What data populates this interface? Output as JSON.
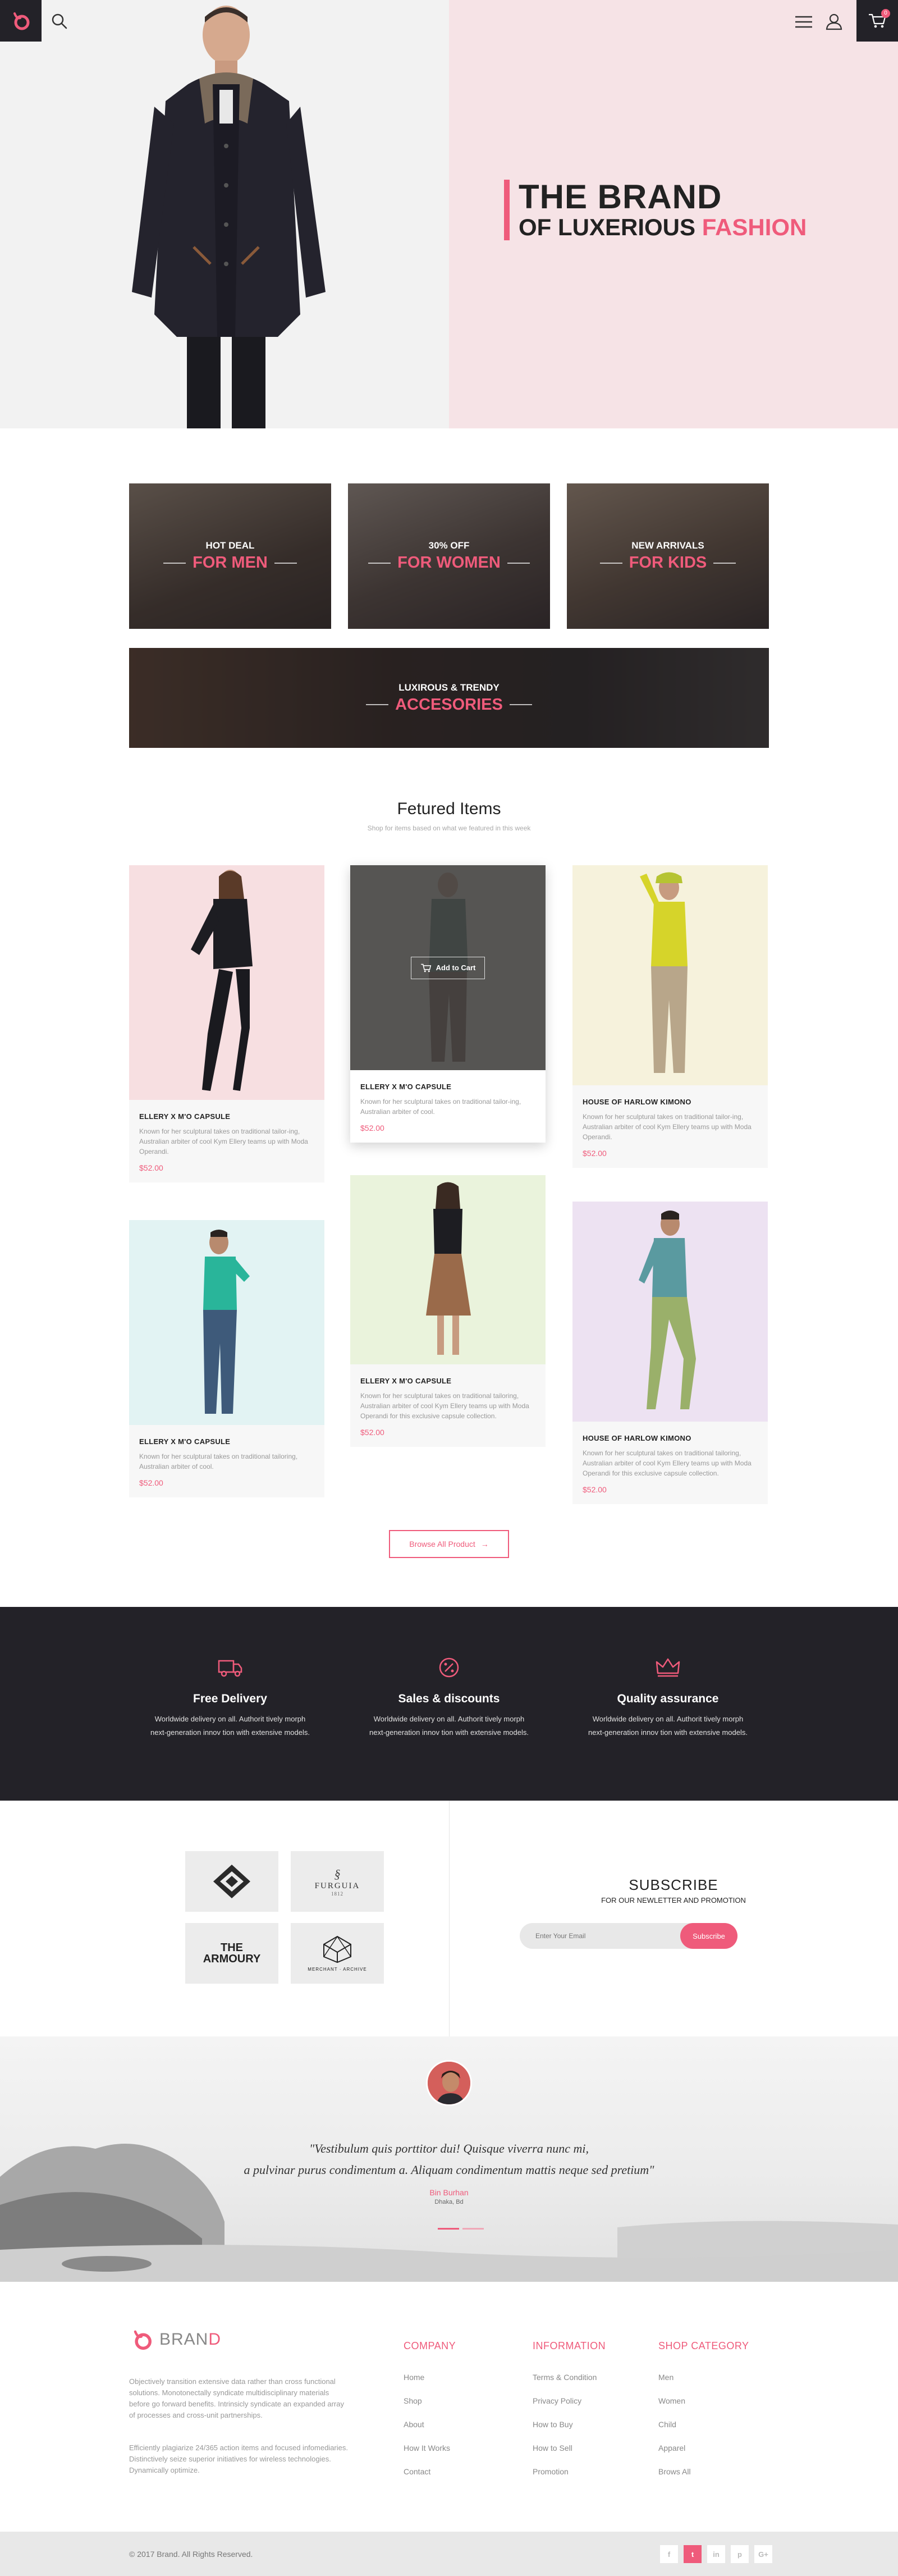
{
  "header": {
    "cart_count": "0"
  },
  "hero": {
    "line1": "THE BRAND",
    "line2_prefix": "OF LUXERIOUS",
    "line2_highlight": "FASHION"
  },
  "categories": [
    {
      "small": "HOT DEAL",
      "big": "FOR MEN"
    },
    {
      "small": "30% OFF",
      "big": "FOR WOMEN"
    },
    {
      "small": "NEW ARRIVALS",
      "big": "FOR KIDS"
    },
    {
      "small": "LUXIROUS & TRENDY",
      "big": "ACCESORIES"
    }
  ],
  "featured": {
    "title": "Fetured Items",
    "subtitle": "Shop for items based on what we featured in this week",
    "add_to_cart": "Add to Cart",
    "items": [
      {
        "name": "ELLERY X M'O CAPSULE",
        "desc": "Known for her sculptural takes on traditional tailor-ing, Australian arbiter of cool Kym Ellery teams up with Moda Operandi.",
        "price": "$52.00",
        "bg": "#f7dfe1"
      },
      {
        "name": "ELLERY X M'O CAPSULE",
        "desc": "Known for her sculptural takes on traditional tailor-ing, Australian arbiter of cool.",
        "price": "$52.00",
        "bg": "#e9e3d8"
      },
      {
        "name": "HOUSE OF HARLOW KIMONO",
        "desc": "Known for her sculptural takes on traditional tailor-ing, Australian arbiter of cool Kym Ellery teams up with Moda Operandi.",
        "price": "$52.00",
        "bg": "#f6f2dc"
      },
      {
        "name": "ELLERY X M'O CAPSULE",
        "desc": "Known for her sculptural takes on traditional tailoring, Australian arbiter of cool.",
        "price": "$52.00",
        "bg": "#e2f3f3"
      },
      {
        "name": "ELLERY X M'O CAPSULE",
        "desc": "Known for her sculptural takes on traditional tailoring, Australian arbiter of cool Kym Ellery teams up with Moda Operandi for this exclusive capsule collection.",
        "price": "$52.00",
        "bg": "#eaf3dc"
      },
      {
        "name": "HOUSE OF HARLOW KIMONO",
        "desc": "Known for her sculptural takes on traditional tailoring, Australian arbiter of cool Kym Ellery teams up with Moda Operandi for this exclusive capsule collection.",
        "price": "$52.00",
        "bg": "#ede2f2"
      }
    ],
    "browse_label": "Browse All Product"
  },
  "features": [
    {
      "title": "Free Delivery",
      "desc_1": "Worldwide delivery on all. Authorit tively morph",
      "desc_2": "next-generation innov tion with extensive models."
    },
    {
      "title": "Sales & discounts",
      "desc_1": "Worldwide delivery on all. Authorit tively morph",
      "desc_2": "next-generation innov tion with extensive models."
    },
    {
      "title": "Quality assurance",
      "desc_1": "Worldwide delivery on all. Authorit tively morph",
      "desc_2": "next-generation innov tion with extensive models."
    }
  ],
  "brands": [
    {
      "name": "",
      "sub": ""
    },
    {
      "name": "FURGUIA",
      "sub": "1812"
    },
    {
      "name": "THE ARMOURY",
      "sub": ""
    },
    {
      "name": "MERCHANT · ARCHIVE",
      "sub": ""
    }
  ],
  "subscribe": {
    "title": "SUBSCRIBE",
    "subtitle": "FOR OUR NEWLETTER AND PROMOTION",
    "placeholder": "Enter Your Email",
    "button": "Subscribe"
  },
  "testimonial": {
    "quote_line1": "\"Vestibulum quis porttitor dui! Quisque viverra nunc mi,",
    "quote_line2": "a pulvinar purus condimentum a. Aliquam condimentum mattis neque sed pretium\"",
    "name": "Bin Burhan",
    "location": "Dhaka, Bd"
  },
  "footer": {
    "brand_prefix": "BRAN",
    "brand_suffix": "D",
    "text1_lines": [
      "Objectively transition extensive data rather than cross functional",
      "solutions. Monotonectally syndicate multidisciplinary materials",
      "before go forward benefits. Intrinsicly syndicate an expanded array",
      "of processes and cross-unit partnerships."
    ],
    "text2_lines": [
      "Efficiently plagiarize 24/365 action items and focused infomediaries.",
      "Distinctively seize superior initiatives for wireless technologies.",
      "Dynamically optimize."
    ],
    "columns": [
      {
        "heading": "COMPANY",
        "links": [
          "Home",
          "Shop",
          "About",
          "How It Works",
          "Contact"
        ]
      },
      {
        "heading": "INFORMATION",
        "links": [
          "Terms & Condition",
          "Privacy Policy",
          "How to Buy",
          "How to Sell",
          "Promotion"
        ]
      },
      {
        "heading": "SHOP CATEGORY",
        "links": [
          "Men",
          "Women",
          "Child",
          "Apparel",
          "Brows All"
        ]
      }
    ],
    "copyright": "© 2017 Brand. All Rights Reserved.",
    "social": [
      "f",
      "t",
      "in",
      "p",
      "G+"
    ]
  }
}
